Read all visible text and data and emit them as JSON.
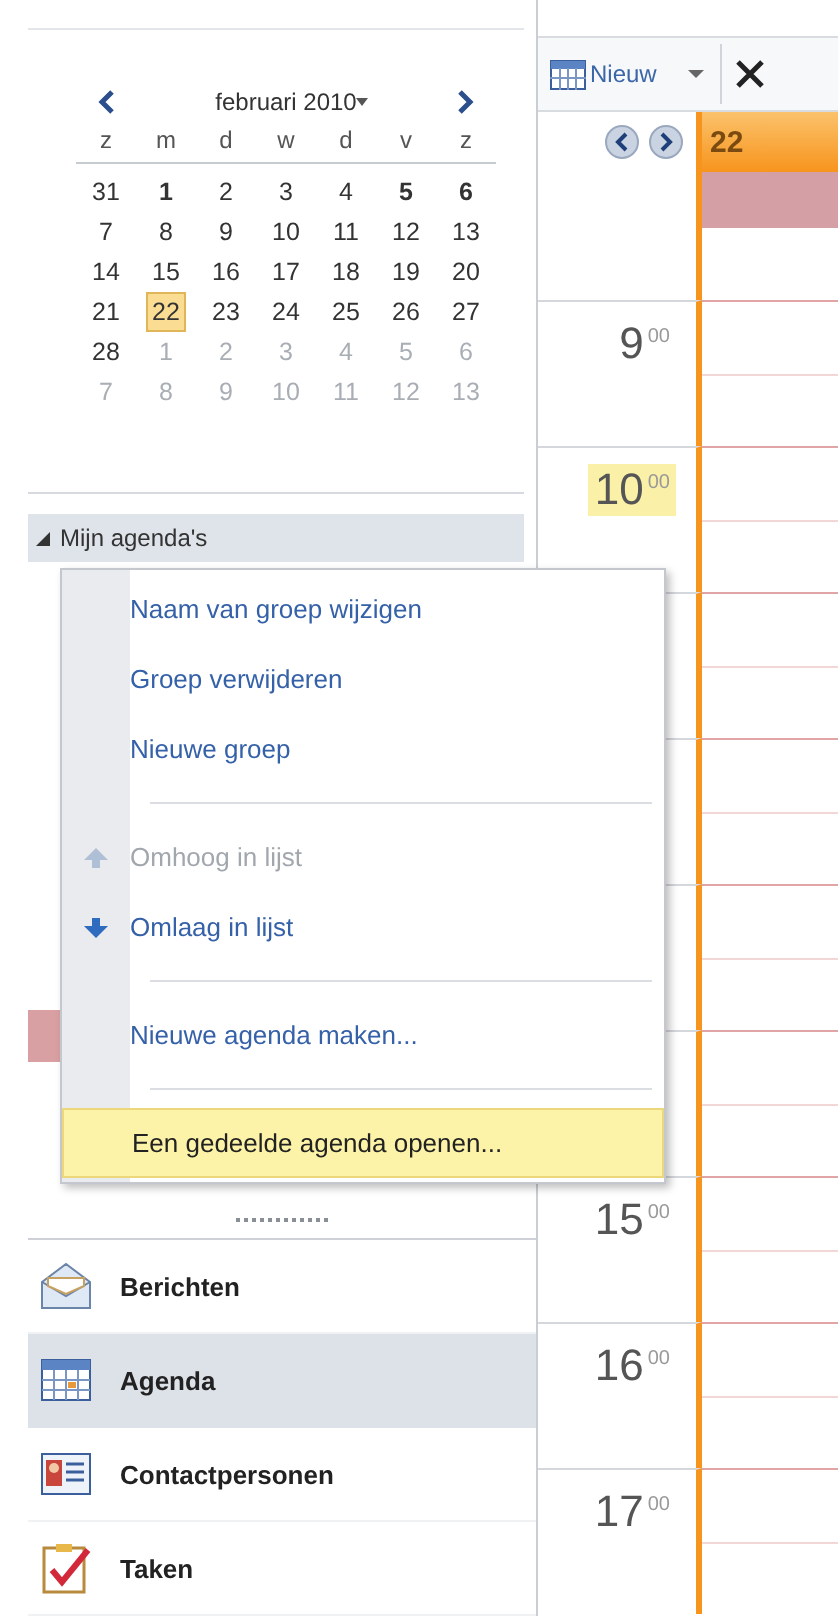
{
  "mini_calendar": {
    "month": "februari 2010",
    "weekdays": [
      "z",
      "m",
      "d",
      "w",
      "d",
      "v",
      "z"
    ],
    "weeks": [
      [
        {
          "day": "31",
          "muted": false,
          "bold": false,
          "selected": false
        },
        {
          "day": "1",
          "muted": false,
          "bold": true,
          "selected": false
        },
        {
          "day": "2",
          "muted": false,
          "bold": false,
          "selected": false
        },
        {
          "day": "3",
          "muted": false,
          "bold": false,
          "selected": false
        },
        {
          "day": "4",
          "muted": false,
          "bold": false,
          "selected": false
        },
        {
          "day": "5",
          "muted": false,
          "bold": true,
          "selected": false
        },
        {
          "day": "6",
          "muted": false,
          "bold": true,
          "selected": false
        }
      ],
      [
        {
          "day": "7",
          "muted": false,
          "bold": false,
          "selected": false
        },
        {
          "day": "8",
          "muted": false,
          "bold": false,
          "selected": false
        },
        {
          "day": "9",
          "muted": false,
          "bold": false,
          "selected": false
        },
        {
          "day": "10",
          "muted": false,
          "bold": false,
          "selected": false
        },
        {
          "day": "11",
          "muted": false,
          "bold": false,
          "selected": false
        },
        {
          "day": "12",
          "muted": false,
          "bold": false,
          "selected": false
        },
        {
          "day": "13",
          "muted": false,
          "bold": false,
          "selected": false
        }
      ],
      [
        {
          "day": "14",
          "muted": false,
          "bold": false,
          "selected": false
        },
        {
          "day": "15",
          "muted": false,
          "bold": false,
          "selected": false
        },
        {
          "day": "16",
          "muted": false,
          "bold": false,
          "selected": false
        },
        {
          "day": "17",
          "muted": false,
          "bold": false,
          "selected": false
        },
        {
          "day": "18",
          "muted": false,
          "bold": false,
          "selected": false
        },
        {
          "day": "19",
          "muted": false,
          "bold": false,
          "selected": false
        },
        {
          "day": "20",
          "muted": false,
          "bold": false,
          "selected": false
        }
      ],
      [
        {
          "day": "21",
          "muted": false,
          "bold": false,
          "selected": false
        },
        {
          "day": "22",
          "muted": false,
          "bold": false,
          "selected": true
        },
        {
          "day": "23",
          "muted": false,
          "bold": false,
          "selected": false
        },
        {
          "day": "24",
          "muted": false,
          "bold": false,
          "selected": false
        },
        {
          "day": "25",
          "muted": false,
          "bold": false,
          "selected": false
        },
        {
          "day": "26",
          "muted": false,
          "bold": false,
          "selected": false
        },
        {
          "day": "27",
          "muted": false,
          "bold": false,
          "selected": false
        }
      ],
      [
        {
          "day": "28",
          "muted": false,
          "bold": false,
          "selected": false
        },
        {
          "day": "1",
          "muted": true,
          "bold": false,
          "selected": false
        },
        {
          "day": "2",
          "muted": true,
          "bold": false,
          "selected": false
        },
        {
          "day": "3",
          "muted": true,
          "bold": false,
          "selected": false
        },
        {
          "day": "4",
          "muted": true,
          "bold": false,
          "selected": false
        },
        {
          "day": "5",
          "muted": true,
          "bold": false,
          "selected": false
        },
        {
          "day": "6",
          "muted": true,
          "bold": false,
          "selected": false
        }
      ],
      [
        {
          "day": "7",
          "muted": true,
          "bold": false,
          "selected": false
        },
        {
          "day": "8",
          "muted": true,
          "bold": false,
          "selected": false
        },
        {
          "day": "9",
          "muted": true,
          "bold": false,
          "selected": false
        },
        {
          "day": "10",
          "muted": true,
          "bold": false,
          "selected": false
        },
        {
          "day": "11",
          "muted": true,
          "bold": false,
          "selected": false
        },
        {
          "day": "12",
          "muted": true,
          "bold": false,
          "selected": false
        },
        {
          "day": "13",
          "muted": true,
          "bold": false,
          "selected": false
        }
      ]
    ]
  },
  "group_header": {
    "label": "Mijn agenda's",
    "expanded": true
  },
  "context_menu": [
    {
      "kind": "item",
      "label": "Naam van groep wijzigen",
      "disabled": false,
      "highlighted": false
    },
    {
      "kind": "item",
      "label": "Groep verwijderen",
      "disabled": false,
      "highlighted": false
    },
    {
      "kind": "item",
      "label": "Nieuwe groep",
      "disabled": false,
      "highlighted": false
    },
    {
      "kind": "separator"
    },
    {
      "kind": "item",
      "label": "Omhoog in lijst",
      "disabled": true,
      "highlighted": false
    },
    {
      "kind": "item",
      "label": "Omlaag in lijst",
      "disabled": false,
      "highlighted": false
    },
    {
      "kind": "separator"
    },
    {
      "kind": "item",
      "label": "Nieuwe agenda maken...",
      "disabled": false,
      "highlighted": false
    },
    {
      "kind": "separator"
    },
    {
      "kind": "item",
      "label": "Een gedeelde agenda openen...",
      "disabled": false,
      "highlighted": true
    }
  ],
  "nav_buttons": [
    {
      "label": "Berichten",
      "selected": false
    },
    {
      "label": "Agenda",
      "selected": true
    },
    {
      "label": "Contactpersonen",
      "selected": false
    },
    {
      "label": "Taken",
      "selected": false
    }
  ],
  "toolbar": {
    "new_button": "Nieuw"
  },
  "day_header": {
    "date": "22"
  },
  "hours": [
    {
      "label": "9",
      "minutes": "00",
      "current": false
    },
    {
      "label": "10",
      "minutes": "00",
      "current": true
    },
    {
      "label": "15",
      "minutes": "00",
      "current": false
    },
    {
      "label": "16",
      "minutes": "00",
      "current": false
    },
    {
      "label": "17",
      "minutes": "00",
      "current": false
    }
  ]
}
